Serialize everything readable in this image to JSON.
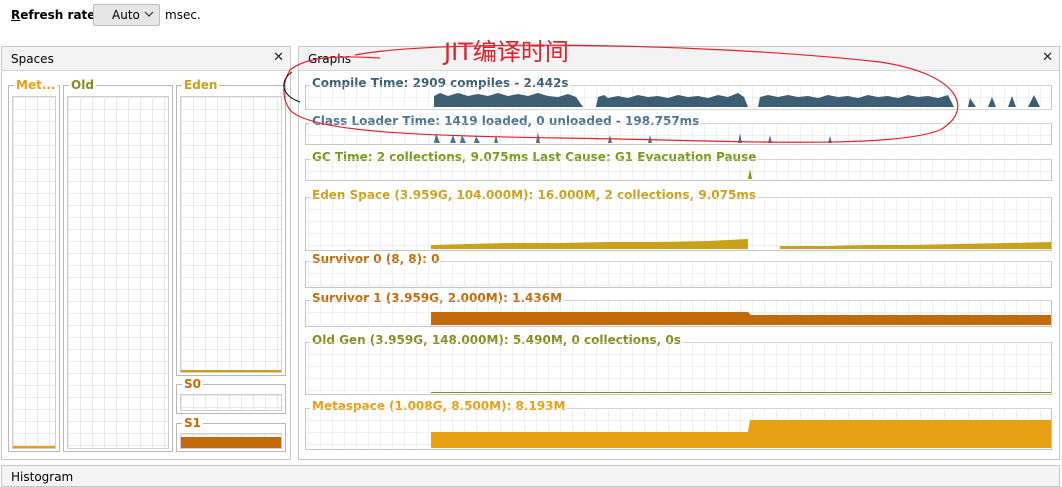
{
  "toolbar": {
    "refresh_label_first": "R",
    "refresh_label_rest": "efresh rate:",
    "refresh_value": "Auto",
    "unit": "msec."
  },
  "spaces_panel": {
    "title": "Spaces",
    "close": "✕",
    "columns": {
      "meta": "Met...",
      "old": "Old",
      "eden": "Eden",
      "s0": "S0",
      "s1": "S1"
    }
  },
  "graphs_panel": {
    "title": "Graphs",
    "close": "✕"
  },
  "histogram_panel": {
    "title": "Histogram"
  },
  "annotation": {
    "text": "JIT编译时间"
  },
  "graphs": {
    "compile": "Compile Time: 2909 compiles - 2.442s",
    "classloader": "Class Loader Time: 1419 loaded, 0 unloaded - 198.757ms",
    "gc": "GC Time: 2 collections, 9.075ms Last Cause: G1 Evacuation Pause",
    "eden": "Eden Space (3.959G, 104.000M): 16.000M, 2 collections, 9.075ms",
    "s0": "Survivor 0 (8, 8): 0",
    "s1": "Survivor 1 (3.959G, 2.000M): 1.436M",
    "old": "Old Gen (3.959G, 148.000M): 5.490M, 0 collections, 0s",
    "meta": "Metaspace (1.008G, 8.500M): 8.193M"
  },
  "colors": {
    "compile": "#3d5f73",
    "classloader": "#4d7390",
    "gc": "#7a9a1a",
    "eden": "#c9a21a",
    "survivor": "#c26a0c",
    "old": "#8a8a20",
    "meta": "#e8a012",
    "annotation": "#e0232b"
  }
}
